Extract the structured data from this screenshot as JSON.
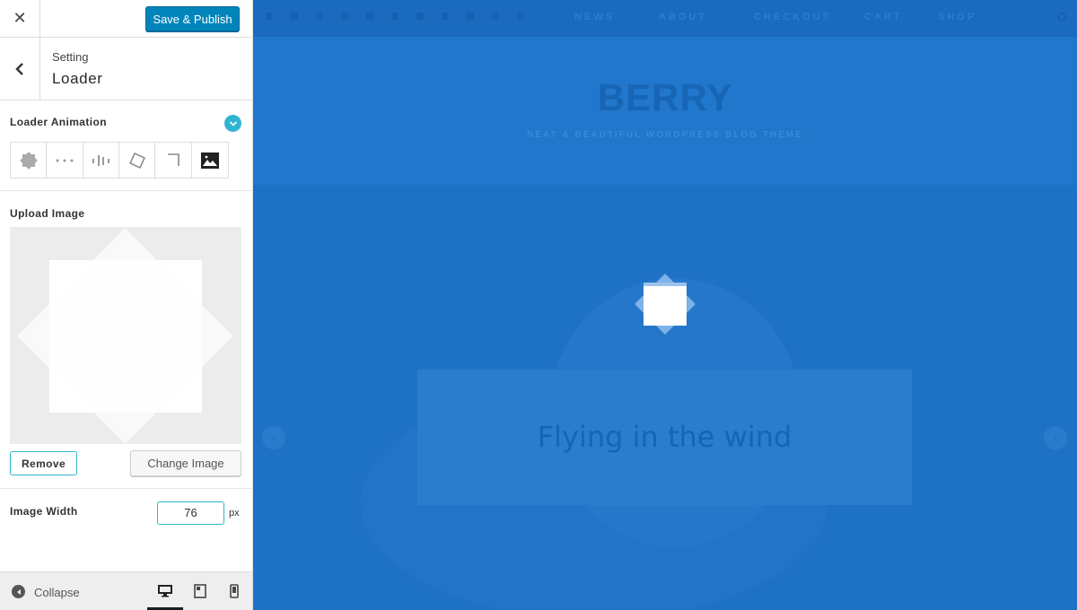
{
  "header": {
    "close_label": "✕",
    "publish_label": "Save & Publish"
  },
  "section": {
    "breadcrumb": "Setting",
    "title": "Loader"
  },
  "loader_animation": {
    "label": "Loader Animation",
    "options": [
      {
        "name": "star-spinner",
        "icon": "star-icon"
      },
      {
        "name": "three-dots",
        "icon": "dots-icon"
      },
      {
        "name": "bars",
        "icon": "bars-icon"
      },
      {
        "name": "rotating-square",
        "icon": "square-icon"
      },
      {
        "name": "corner",
        "icon": "corner-icon"
      },
      {
        "name": "custom-image",
        "icon": "image-icon"
      }
    ]
  },
  "upload_image": {
    "label": "Upload Image",
    "remove_label": "Remove",
    "change_label": "Change Image"
  },
  "image_width": {
    "label": "Image Width",
    "value": "76",
    "unit": "px"
  },
  "footer": {
    "collapse_label": "Collapse",
    "devices": [
      "desktop",
      "tablet",
      "mobile"
    ],
    "active_device": "desktop"
  },
  "preview": {
    "nav_items": [
      "NEWS",
      "ABOUT",
      "CHECKOUT",
      "CART",
      "SHOP"
    ],
    "site_title": "BERRY",
    "tagline": "NEAT & BEAUTIFUL WORDPRESS BLOG THEME",
    "slide_title": "Flying in the wind",
    "accent_color": "#1f74c9"
  }
}
